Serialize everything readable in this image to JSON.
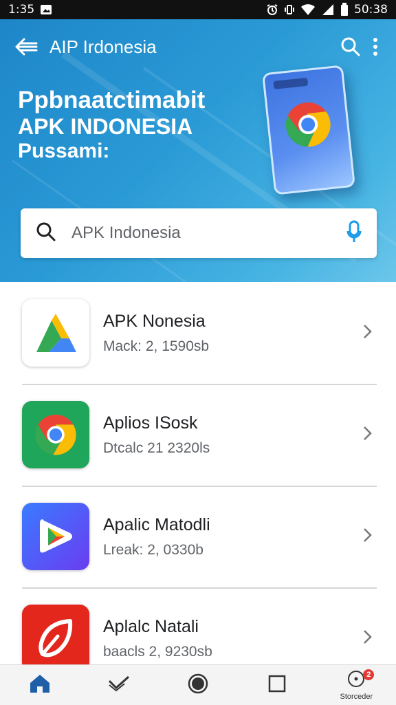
{
  "status_bar": {
    "time": "1:35",
    "clock_right": "50:38",
    "icons": [
      "gallery-icon",
      "alarm-icon",
      "vibrate-icon",
      "wifi-icon",
      "signal-icon",
      "battery-icon"
    ]
  },
  "app_bar": {
    "title": "AIP Irdonesia",
    "back_icon": "back-arrow-icon",
    "search_icon": "search-icon",
    "menu_icon": "more-vert-icon"
  },
  "hero": {
    "line1": "Ppbnaatctimabit",
    "line2": "APK INDONESIA",
    "line3": "Pussami:"
  },
  "search": {
    "value": "APK Indonesia",
    "placeholder": "APK Indonesia",
    "search_icon": "search-icon",
    "mic_icon": "mic-icon"
  },
  "apps": [
    {
      "title": "APK Nonesia",
      "subtitle": "Mack: 2, 1590sb",
      "icon": "triangle-logo-icon"
    },
    {
      "title": "Aplios ISosk",
      "subtitle": "Dtcalc 21 2320ls",
      "icon": "chrome-logo-icon"
    },
    {
      "title": "Apalic Matodli",
      "subtitle": "Lreak: 2, 0330b",
      "icon": "play-logo-icon"
    },
    {
      "title": "Aplalc Natali",
      "subtitle": "baacls 2, 9230sb",
      "icon": "leaf-logo-icon"
    }
  ],
  "bottom_nav": {
    "items": [
      {
        "icon": "home-icon",
        "label": ""
      },
      {
        "icon": "check-icon",
        "label": ""
      },
      {
        "icon": "record-icon",
        "label": ""
      },
      {
        "icon": "square-icon",
        "label": ""
      },
      {
        "icon": "info-circle-icon",
        "label": "Storceder"
      }
    ],
    "badge": "2"
  },
  "colors": {
    "hero_start": "#1e86c8",
    "hero_end": "#6cc6ea",
    "mic": "#1a9be8",
    "nav_active": "#1f5fa8"
  }
}
